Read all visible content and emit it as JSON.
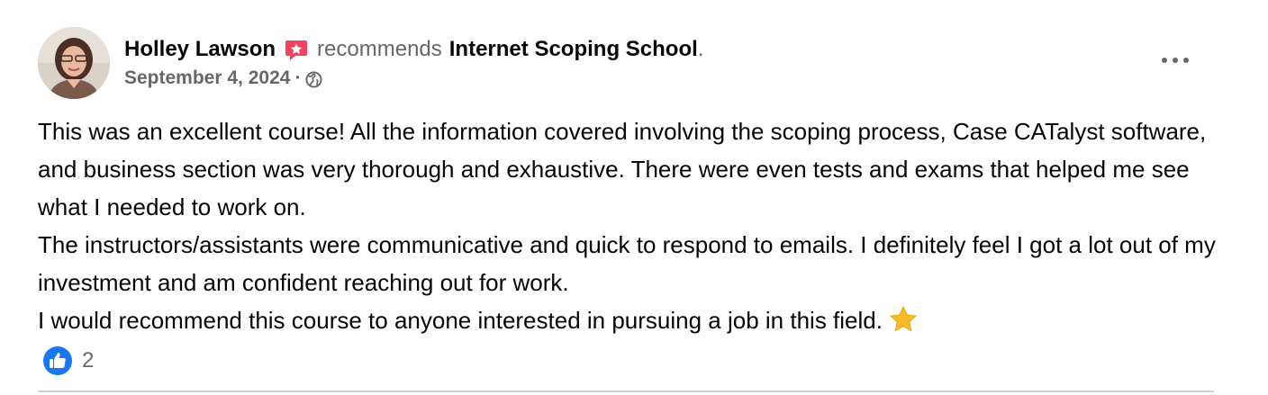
{
  "post": {
    "author": "Holley Lawson",
    "verb": "recommends",
    "page_name": "Internet Scoping School",
    "title_end": ".",
    "date": "September 4, 2024",
    "separator": "·",
    "privacy_icon": "globe-icon",
    "recommend_icon": "recommend-badge-icon",
    "more_icon": "more-options-icon",
    "body": [
      "This was an excellent course! All the information covered involving the scoping process, Case CATalyst software, and business section was very thorough and exhaustive. There were even tests and exams that helped me see what I needed to work on.",
      "The instructors/assistants were communicative and quick to respond to emails. I definitely feel I got a lot out of my investment and am confident reaching out for work.",
      "I would recommend this course to anyone interested in pursuing a job in this field."
    ],
    "emoji": "star-icon",
    "reactions": {
      "icon": "like-icon",
      "count": "2"
    }
  },
  "colors": {
    "primary_text": "#050505",
    "secondary_text": "#65676b",
    "like_blue": "#1877f2",
    "recommend_red": "#f3425f",
    "star_yellow": "#f7b928",
    "divider": "#ced0d4"
  }
}
